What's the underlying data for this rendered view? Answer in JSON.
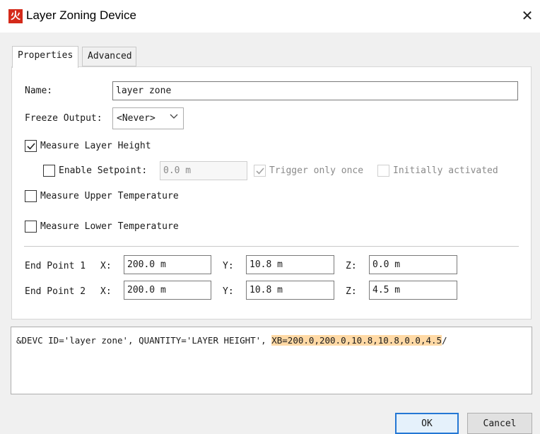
{
  "window": {
    "title": "Layer Zoning Device",
    "app_icon_glyph": "火",
    "close_glyph": "✕"
  },
  "tabs": [
    {
      "label": "Properties",
      "active": true
    },
    {
      "label": "Advanced",
      "active": false
    }
  ],
  "properties": {
    "name_label": "Name:",
    "name_value": "layer zone",
    "freeze_label": "Freeze Output:",
    "freeze_value": "<Never>",
    "measure_layer_height": {
      "label": "Measure Layer Height",
      "checked": true
    },
    "enable_setpoint": {
      "label": "Enable Setpoint:",
      "checked": false,
      "value": "0.0 m"
    },
    "trigger_only_once": {
      "label": "Trigger only once",
      "checked": true,
      "disabled": true
    },
    "initially_activated": {
      "label": "Initially activated",
      "checked": false,
      "disabled": true
    },
    "measure_upper_temperature": {
      "label": "Measure Upper Temperature",
      "checked": false
    },
    "measure_lower_temperature": {
      "label": "Measure Lower Temperature",
      "checked": false
    },
    "end_point_1": {
      "label": "End Point 1",
      "x_label": "X:",
      "x": "200.0 m",
      "y_label": "Y:",
      "y": "10.8 m",
      "z_label": "Z:",
      "z": "0.0 m"
    },
    "end_point_2": {
      "label": "End Point 2",
      "x_label": "X:",
      "x": "200.0 m",
      "y_label": "Y:",
      "y": "10.8 m",
      "z_label": "Z:",
      "z": "4.5 m"
    }
  },
  "output": {
    "text_main": "&DEVC ID='layer zone', QUANTITY='LAYER HEIGHT', ",
    "text_highlight": "XB=200.0,200.0,10.8,10.8,0.0,4.5",
    "text_tail": "/"
  },
  "buttons": {
    "ok": "OK",
    "cancel": "Cancel"
  },
  "colors": {
    "accent": "#2477d4",
    "highlight": "#ffd9a5",
    "app_icon": "#d42a1a"
  }
}
